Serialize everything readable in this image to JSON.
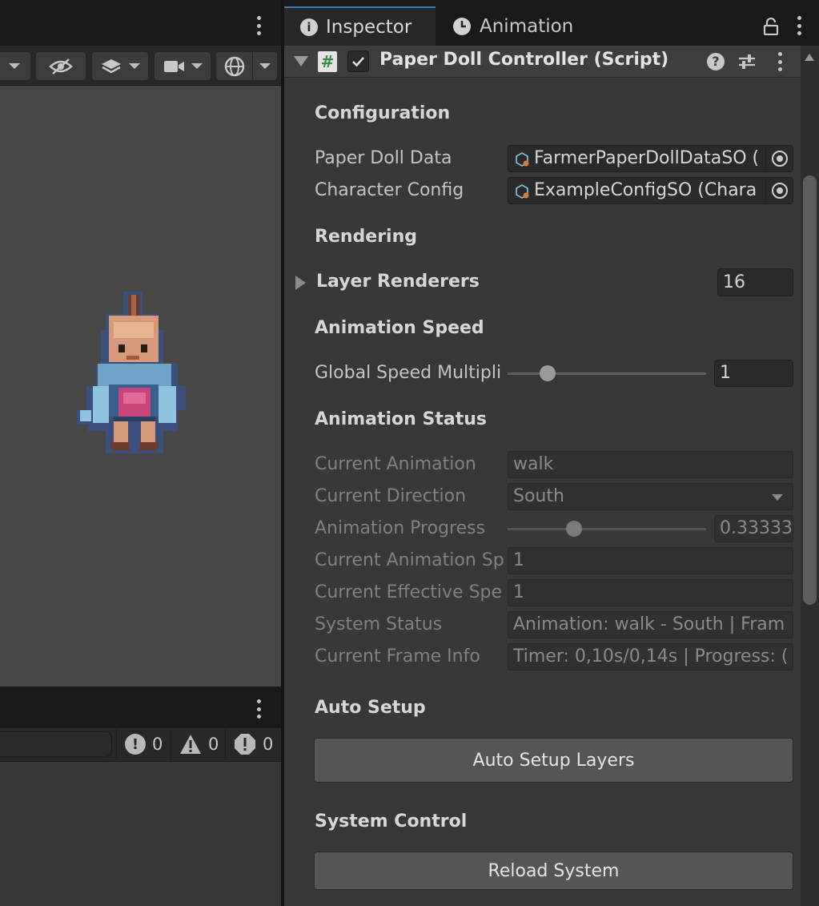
{
  "scene": {
    "toolbar_icons": [
      "hidden-eye-icon",
      "layers-icon",
      "camera-icon",
      "gizmo-globe-icon"
    ]
  },
  "console": {
    "counts": {
      "info": "0",
      "warnings": "0",
      "errors": "0"
    }
  },
  "tabs": [
    {
      "label": "Inspector",
      "icon": "info-icon",
      "active": true
    },
    {
      "label": "Animation",
      "icon": "clock-icon",
      "active": false
    }
  ],
  "component": {
    "title": "Paper Doll Controller (Script)",
    "enabled": true,
    "icon": "script-hash-icon"
  },
  "sections": {
    "configuration": "Configuration",
    "rendering": "Rendering",
    "animation_speed": "Animation Speed",
    "animation_status": "Animation Status",
    "auto_setup": "Auto Setup",
    "system_control": "System Control"
  },
  "configuration": {
    "paper_doll_data": {
      "label": "Paper Doll Data",
      "value": "FarmerPaperDollDataSO ("
    },
    "character_config": {
      "label": "Character Config",
      "value": "ExampleConfigSO (Chara"
    }
  },
  "rendering": {
    "layer_renderers": {
      "label": "Layer Renderers",
      "value": "16"
    }
  },
  "speed": {
    "global": {
      "label": "Global Speed Multipli",
      "value": "1",
      "slider_fraction": 0.2
    }
  },
  "status": {
    "current_animation": {
      "label": "Current Animation",
      "value": "walk"
    },
    "current_direction": {
      "label": "Current Direction",
      "value": "South"
    },
    "animation_progress": {
      "label": "Animation Progress",
      "value": "0.33333",
      "slider_fraction": 0.333
    },
    "current_animation_speed": {
      "label": "Current Animation Sp",
      "value": "1"
    },
    "current_effective_speed": {
      "label": "Current Effective Spe",
      "value": "1"
    },
    "system_status": {
      "label": "System Status",
      "value": "Animation: walk - South | Fram"
    },
    "current_frame_info": {
      "label": "Current Frame Info",
      "value": "Timer: 0,10s/0,14s | Progress: ("
    }
  },
  "buttons": {
    "auto_setup_layers": "Auto Setup Layers",
    "reload_system": "Reload System"
  },
  "colors": {
    "accent": "#3a79bb",
    "panel_bg": "#383838",
    "scene_bg": "#474747"
  }
}
